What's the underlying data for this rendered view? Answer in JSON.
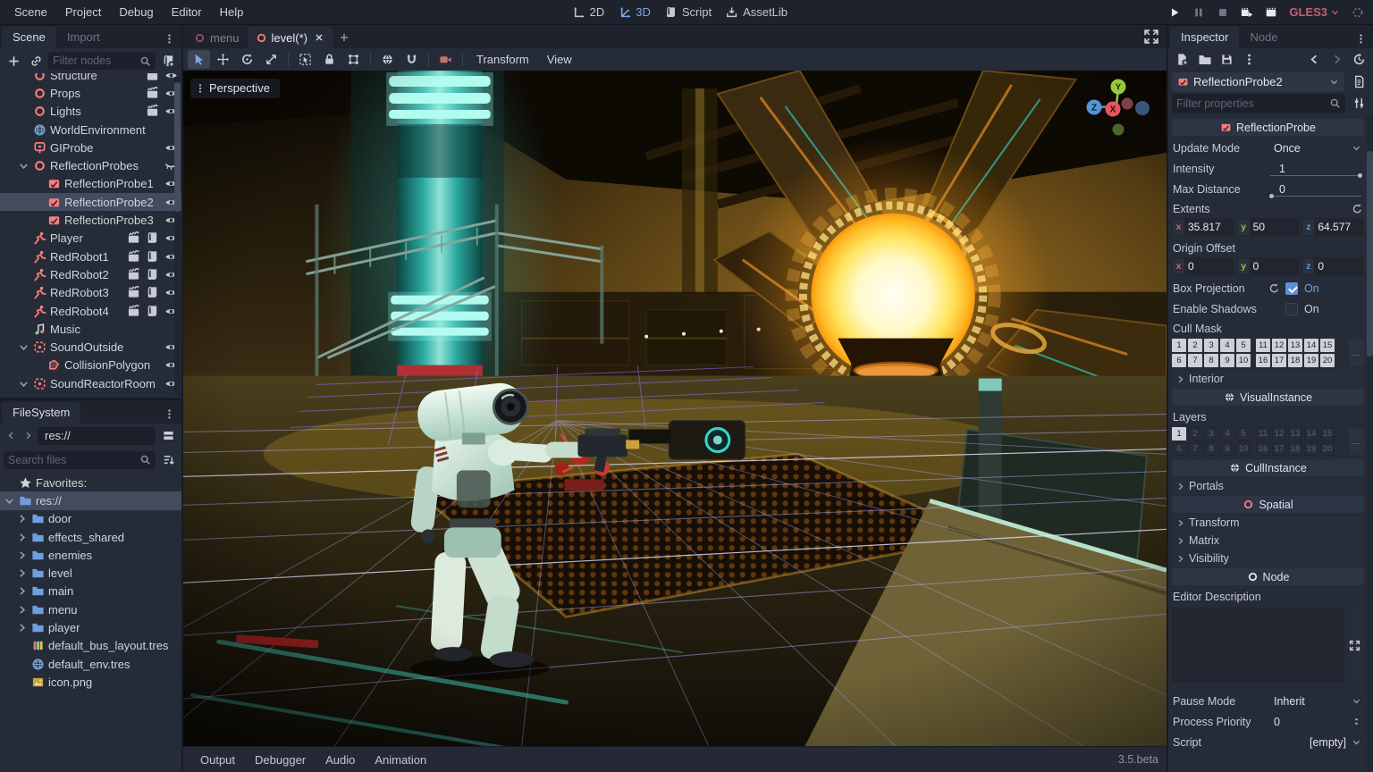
{
  "colors": {
    "accent": "#699ce8",
    "node_red": "#fc7c7c",
    "folder_blue": "#6f9ede",
    "renderer_pink": "#c75d74",
    "selection": "#434b5e",
    "panel": "#262c37"
  },
  "menubar": {
    "items": [
      "Scene",
      "Project",
      "Debug",
      "Editor",
      "Help"
    ]
  },
  "workspaces": {
    "items": [
      {
        "label": "2D",
        "icon": "ws2d",
        "active": false
      },
      {
        "label": "3D",
        "icon": "ws3d",
        "active": true
      },
      {
        "label": "Script",
        "icon": "script",
        "active": false
      },
      {
        "label": "AssetLib",
        "icon": "assetlib",
        "active": false
      }
    ]
  },
  "run_bar": {
    "renderer": "GLES3"
  },
  "scene_dock": {
    "tabs": {
      "scene": "Scene",
      "import": "Import"
    },
    "filter_placeholder": "Filter nodes",
    "rows": [
      {
        "label": "Structure",
        "icon": "node",
        "depth": 1,
        "buttons": [
          "groups",
          "eye"
        ],
        "clipped": true
      },
      {
        "label": "Props",
        "icon": "node",
        "depth": 1,
        "buttons": [
          "groups",
          "eye"
        ]
      },
      {
        "label": "Lights",
        "icon": "node",
        "depth": 1,
        "buttons": [
          "groups",
          "eye"
        ]
      },
      {
        "label": "WorldEnvironment",
        "icon": "globe",
        "depth": 1,
        "buttons": []
      },
      {
        "label": "GIProbe",
        "icon": "giprobe",
        "depth": 1,
        "buttons": [
          "eye"
        ]
      },
      {
        "label": "ReflectionProbes",
        "icon": "node",
        "depth": 1,
        "arrow": true,
        "buttons": [
          "eye-closed"
        ]
      },
      {
        "label": "ReflectionProbe1",
        "icon": "probe",
        "depth": 2,
        "buttons": [
          "eye"
        ]
      },
      {
        "label": "ReflectionProbe2",
        "icon": "probe",
        "depth": 2,
        "buttons": [
          "eye"
        ],
        "selected": true
      },
      {
        "label": "ReflectionProbe3",
        "icon": "probe",
        "depth": 2,
        "buttons": [
          "eye"
        ]
      },
      {
        "label": "Player",
        "icon": "person",
        "depth": 1,
        "buttons": [
          "groups",
          "script",
          "eye"
        ]
      },
      {
        "label": "RedRobot1",
        "icon": "person",
        "depth": 1,
        "buttons": [
          "groups",
          "script",
          "eye"
        ]
      },
      {
        "label": "RedRobot2",
        "icon": "person",
        "depth": 1,
        "buttons": [
          "groups",
          "script",
          "eye"
        ]
      },
      {
        "label": "RedRobot3",
        "icon": "person",
        "depth": 1,
        "buttons": [
          "groups",
          "script",
          "eye"
        ]
      },
      {
        "label": "RedRobot4",
        "icon": "person",
        "depth": 1,
        "buttons": [
          "groups",
          "script",
          "eye"
        ]
      },
      {
        "label": "Music",
        "icon": "music",
        "depth": 1,
        "buttons": []
      },
      {
        "label": "SoundOutside",
        "icon": "area",
        "depth": 1,
        "arrow": true,
        "buttons": [
          "eye"
        ]
      },
      {
        "label": "CollisionPolygon",
        "icon": "polygon",
        "depth": 2,
        "buttons": [
          "eye"
        ]
      },
      {
        "label": "SoundReactorRoom",
        "icon": "area",
        "depth": 1,
        "arrow": true,
        "buttons": [
          "eye"
        ]
      }
    ]
  },
  "filesystem_dock": {
    "tab": "FileSystem",
    "path": "res://",
    "search_placeholder": "Search files",
    "rows": [
      {
        "label": "Favorites:",
        "icon": "star",
        "depth": 0
      },
      {
        "label": "res://",
        "icon": "folder",
        "depth": 0,
        "arrow": "down",
        "selected": true
      },
      {
        "label": "door",
        "icon": "folder",
        "depth": 1,
        "arrow": "right"
      },
      {
        "label": "effects_shared",
        "icon": "folder",
        "depth": 1,
        "arrow": "right"
      },
      {
        "label": "enemies",
        "icon": "folder",
        "depth": 1,
        "arrow": "right"
      },
      {
        "label": "level",
        "icon": "folder",
        "depth": 1,
        "arrow": "right"
      },
      {
        "label": "main",
        "icon": "folder",
        "depth": 1,
        "arrow": "right"
      },
      {
        "label": "menu",
        "icon": "folder",
        "depth": 1,
        "arrow": "right"
      },
      {
        "label": "player",
        "icon": "folder",
        "depth": 1,
        "arrow": "right"
      },
      {
        "label": "default_bus_layout.tres",
        "icon": "bus",
        "depth": 1
      },
      {
        "label": "default_env.tres",
        "icon": "globe",
        "depth": 1
      },
      {
        "label": "icon.png",
        "icon": "image",
        "depth": 1
      }
    ]
  },
  "main_view": {
    "tabs": {
      "menu": "menu",
      "level": "level(*)"
    },
    "toolbar_menus": {
      "transform": "Transform",
      "view": "View"
    },
    "perspective_label": "Perspective"
  },
  "bottom_bar": {
    "items": [
      "Output",
      "Debugger",
      "Audio",
      "Animation"
    ],
    "version": "3.5.beta"
  },
  "inspector": {
    "tabs": {
      "inspector": "Inspector",
      "node": "Node"
    },
    "node_name": "ReflectionProbe2",
    "filter_placeholder": "Filter properties",
    "categories": {
      "reflection_probe": "ReflectionProbe",
      "visual_instance": "VisualInstance",
      "cull_instance": "CullInstance",
      "spatial": "Spatial",
      "node": "Node"
    },
    "properties": {
      "update_mode": {
        "label": "Update Mode",
        "value": "Once"
      },
      "intensity": {
        "label": "Intensity",
        "value": "1"
      },
      "max_distance": {
        "label": "Max Distance",
        "value": "0"
      },
      "extents": {
        "label": "Extents",
        "x": "35.817",
        "y": "50",
        "z": "64.577"
      },
      "origin_offset": {
        "label": "Origin Offset",
        "x": "0",
        "y": "0",
        "z": "0"
      },
      "box_projection": {
        "label": "Box Projection",
        "value": "On",
        "checked": true
      },
      "enable_shadows": {
        "label": "Enable Shadows",
        "value": "On",
        "checked": false
      },
      "cull_mask": {
        "label": "Cull Mask"
      },
      "interior": {
        "label": "Interior"
      },
      "layers": {
        "label": "Layers"
      },
      "portals": {
        "label": "Portals"
      },
      "transform": {
        "label": "Transform"
      },
      "matrix": {
        "label": "Matrix"
      },
      "visibility": {
        "label": "Visibility"
      },
      "editor_description": {
        "label": "Editor Description"
      },
      "pause_mode": {
        "label": "Pause Mode",
        "value": "Inherit"
      },
      "process_priority": {
        "label": "Process Priority",
        "value": "0"
      },
      "script": {
        "label": "Script",
        "value": "[empty]"
      }
    },
    "mask_grid": {
      "row1": [
        1,
        2,
        3,
        4,
        5,
        11,
        12,
        13,
        14,
        15
      ],
      "row2": [
        6,
        7,
        8,
        9,
        10,
        16,
        17,
        18,
        19,
        20
      ]
    },
    "cull_mask_on": [
      1,
      2,
      3,
      4,
      5,
      6,
      7,
      8,
      9,
      10,
      11,
      12,
      13,
      14,
      15,
      16,
      17,
      18,
      19,
      20
    ],
    "layers_on": [
      1
    ],
    "more_label": "..."
  }
}
